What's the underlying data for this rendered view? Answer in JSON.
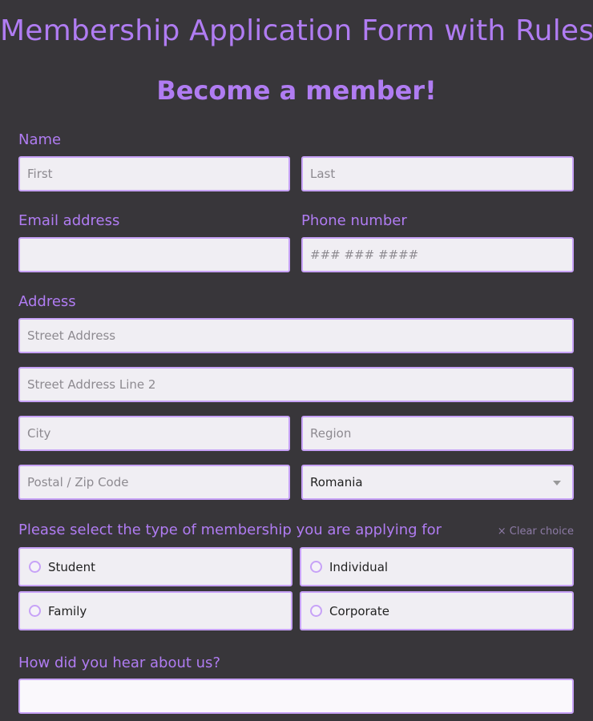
{
  "form": {
    "title": "Membership Application Form with Rules",
    "subtitle": "Become a member!"
  },
  "name": {
    "label": "Name",
    "first_placeholder": "First",
    "last_placeholder": "Last"
  },
  "email": {
    "label": "Email address",
    "value": ""
  },
  "phone": {
    "label": "Phone number",
    "placeholder": "### ### ####"
  },
  "address": {
    "label": "Address",
    "street_placeholder": "Street Address",
    "street2_placeholder": "Street Address Line 2",
    "city_placeholder": "City",
    "region_placeholder": "Region",
    "zip_placeholder": "Postal / Zip Code",
    "country_selected": "Romania"
  },
  "membership": {
    "label": "Please select the type of membership you are applying for",
    "clear_label": "Clear choice",
    "clear_icon": "×",
    "options": [
      "Student",
      "Individual",
      "Family",
      "Corporate"
    ]
  },
  "referral": {
    "label": "How did you hear about us?",
    "value": ""
  }
}
